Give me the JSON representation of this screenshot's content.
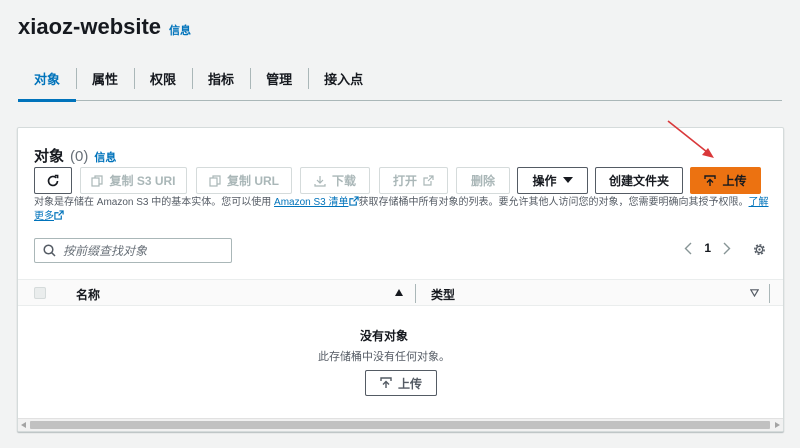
{
  "header": {
    "title": "xiaoz-website",
    "info": "信息"
  },
  "tabs": [
    {
      "label": "对象",
      "active": true
    },
    {
      "label": "属性"
    },
    {
      "label": "权限"
    },
    {
      "label": "指标"
    },
    {
      "label": "管理"
    },
    {
      "label": "接入点"
    }
  ],
  "objects_panel": {
    "title": "对象",
    "count": "(0)",
    "info": "信息",
    "toolbar": {
      "copy_s3_uri": "复制 S3 URI",
      "copy_url": "复制 URL",
      "download": "下载",
      "open": "打开",
      "delete": "删除",
      "actions": "操作",
      "create_folder": "创建文件夹",
      "upload": "上传"
    },
    "description": {
      "part1": "对象是存储在 Amazon S3 中的基本实体。您可以使用",
      "link1": "Amazon S3 清单",
      "part2": "获取存储桶中所有对象的列表。要允许其他人访问您的对象，您需要明确向其授予权限。",
      "link2": "了解更多"
    },
    "search_placeholder": "按前缀查找对象",
    "pagination": {
      "page": "1"
    },
    "columns": {
      "name": "名称",
      "type": "类型"
    },
    "empty": {
      "title": "没有对象",
      "message": "此存储桶中没有任何对象。",
      "upload": "上传"
    }
  },
  "colors": {
    "primary": "#ec7211",
    "link": "#0073bb",
    "annotation_arrow": "#d9383a"
  }
}
